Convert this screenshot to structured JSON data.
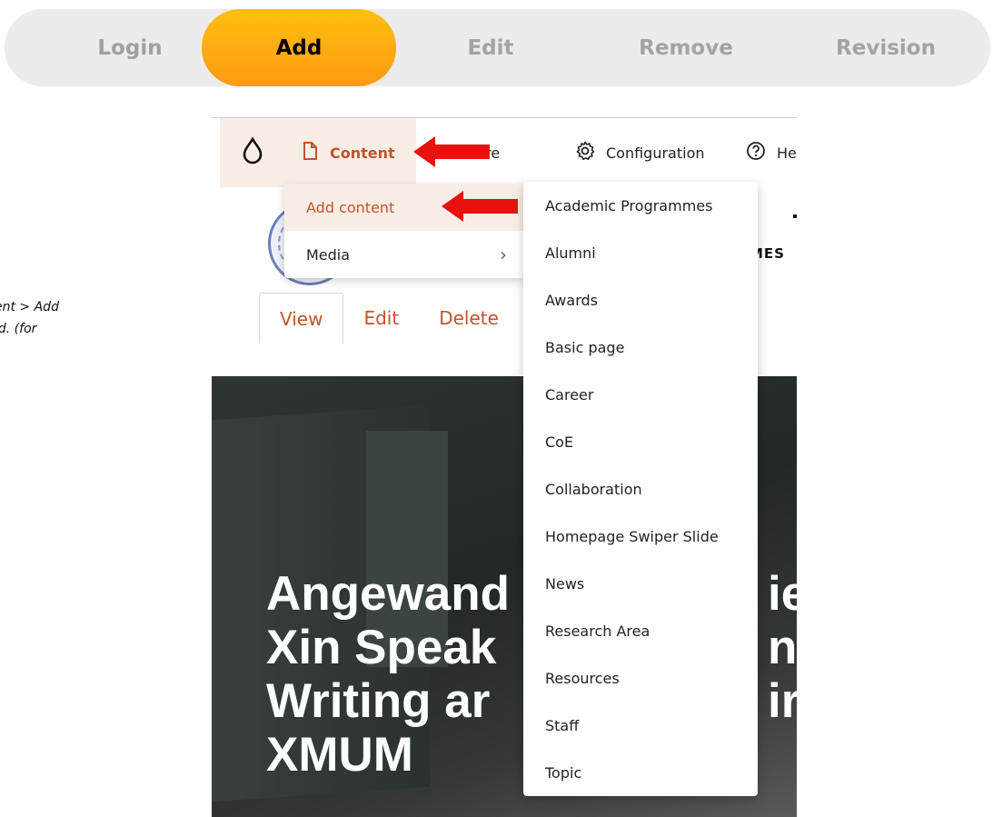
{
  "tabs": [
    {
      "label": "Login"
    },
    {
      "label": "Add"
    },
    {
      "label": "Edit"
    },
    {
      "label": "Remove"
    },
    {
      "label": "Revision"
    }
  ],
  "side_note": {
    "line1": "ent > Add",
    "line2": "ld. (for"
  },
  "toolbar": {
    "content_label": "Content",
    "structure_label": "tructure",
    "configuration_label": "Configuration",
    "help_label": "He"
  },
  "content_menu": {
    "items": [
      {
        "label": "Add content"
      },
      {
        "label": "Media"
      }
    ]
  },
  "content_types": {
    "items": [
      {
        "label": "Academic Programmes"
      },
      {
        "label": "Alumni"
      },
      {
        "label": "Awards"
      },
      {
        "label": "Basic page"
      },
      {
        "label": "Career"
      },
      {
        "label": "CoE"
      },
      {
        "label": "Collaboration"
      },
      {
        "label": "Homepage Swiper Slide"
      },
      {
        "label": "News"
      },
      {
        "label": "Research Area"
      },
      {
        "label": "Resources"
      },
      {
        "label": "Staff"
      },
      {
        "label": "Topic"
      }
    ]
  },
  "site_header": {
    "nav_fragment": "MES"
  },
  "local_tasks": [
    {
      "label": "View"
    },
    {
      "label": "Edit"
    },
    {
      "label": "Delete"
    }
  ],
  "hero": {
    "lines": [
      "Angewand",
      "Xin Speak",
      "Writing ar",
      "XMUM"
    ],
    "right_fragments": [
      "ie",
      "n",
      "ir"
    ]
  },
  "colors": {
    "accent": "#c2542b",
    "tab_active_top": "#ffc010",
    "tab_active_bottom": "#ff9a12",
    "arrow": "#e8110d"
  }
}
